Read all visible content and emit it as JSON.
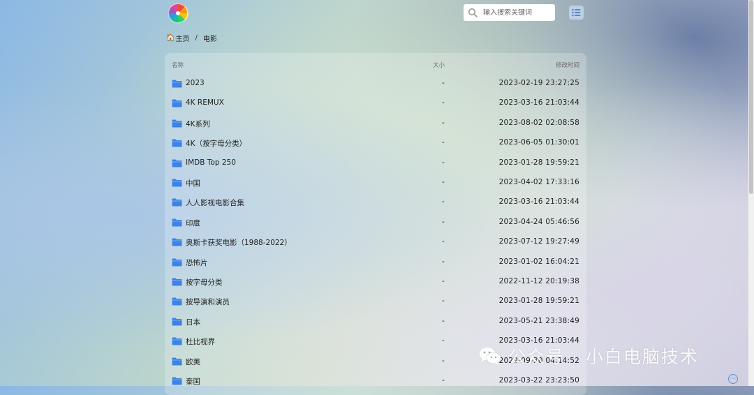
{
  "search": {
    "placeholder": "输入搜索关键词"
  },
  "breadcrumb": {
    "home": "主页",
    "separator": "/",
    "current": "电影"
  },
  "table": {
    "columns": {
      "name": "名称",
      "size": "大小",
      "modified": "修改时间"
    },
    "rows": [
      {
        "name": "2023",
        "size": "-",
        "modified": "2023-02-19 23:27:25"
      },
      {
        "name": "4K REMUX",
        "size": "-",
        "modified": "2023-03-16 21:03:44"
      },
      {
        "name": "4K系列",
        "size": "-",
        "modified": "2023-08-02 02:08:58"
      },
      {
        "name": "4K（按字母分类）",
        "size": "-",
        "modified": "2023-06-05 01:30:01"
      },
      {
        "name": "IMDB Top 250",
        "size": "-",
        "modified": "2023-01-28 19:59:21"
      },
      {
        "name": "中国",
        "size": "-",
        "modified": "2023-04-02 17:33:16"
      },
      {
        "name": "人人影视电影合集",
        "size": "-",
        "modified": "2023-03-16 21:03:44"
      },
      {
        "name": "印度",
        "size": "-",
        "modified": "2023-04-24 05:46:56"
      },
      {
        "name": "奥斯卡获奖电影（1988-2022）",
        "size": "-",
        "modified": "2023-07-12 19:27:49"
      },
      {
        "name": "恐怖片",
        "size": "-",
        "modified": "2023-01-02 16:04:21"
      },
      {
        "name": "按字母分类",
        "size": "-",
        "modified": "2022-11-12 20:19:38"
      },
      {
        "name": "按导演和演员",
        "size": "-",
        "modified": "2023-01-28 19:59:21"
      },
      {
        "name": "日本",
        "size": "-",
        "modified": "2023-05-21 23:38:49"
      },
      {
        "name": "杜比视界",
        "size": "-",
        "modified": "2023-03-16 21:03:44"
      },
      {
        "name": "欧美",
        "size": "-",
        "modified": "2022-09-30 04:14:52"
      },
      {
        "name": "泰国",
        "size": "-",
        "modified": "2023-03-22 23:23:50"
      }
    ]
  },
  "watermark": {
    "text": "公众号 · 小白电脑技术"
  },
  "icons": {
    "logo": "color-wheel-logo",
    "search": "search-icon",
    "menu": "list-menu-icon",
    "home": "home-icon",
    "folder": "folder-icon",
    "wechat": "wechat-icon",
    "corner": "more-icon"
  },
  "colors": {
    "folder": "#3d82e6",
    "accent": "#5a8fd8"
  }
}
